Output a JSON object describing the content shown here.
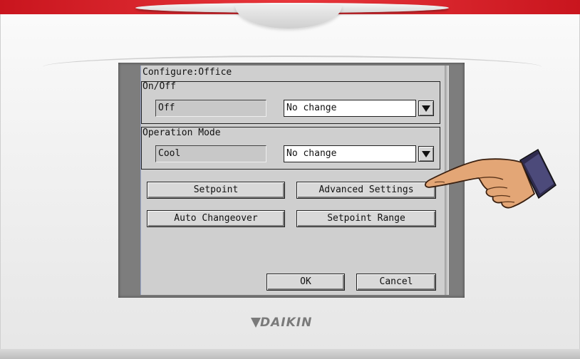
{
  "brand": {
    "logo_text": "DAIKIN",
    "colors": {
      "accent_red": "#d61f27",
      "screen_bg": "#cfcfcf",
      "bezel": "#f2f2f2"
    }
  },
  "screen": {
    "title": "Configure:Office",
    "on_off": {
      "label": "On/Off",
      "current_value": "Off",
      "select_value": "No change"
    },
    "operation_mode": {
      "label": "Operation Mode",
      "current_value": "Cool",
      "select_value": "No change"
    },
    "buttons": {
      "setpoint": "Setpoint",
      "advanced_settings": "Advanced Settings",
      "auto_changeover": "Auto Changeover",
      "setpoint_range": "Setpoint Range",
      "ok": "OK",
      "cancel": "Cancel"
    }
  },
  "icons": {
    "dropdown": "chevron-down-icon",
    "pointer": "pointing-hand-icon"
  }
}
